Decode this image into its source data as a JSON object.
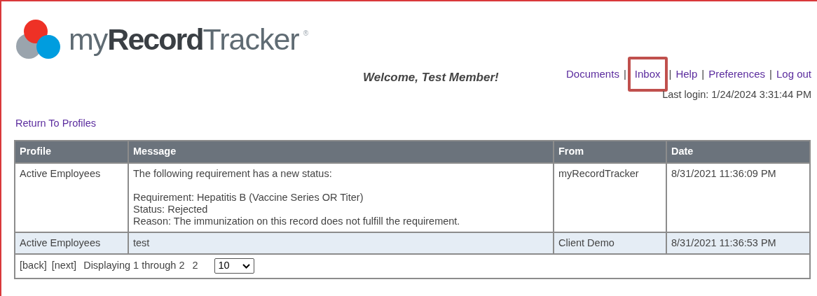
{
  "logo": {
    "text": "my**Record**Tracker",
    "mark": "®"
  },
  "welcome": "Welcome, Test Member!",
  "nav": [
    {
      "label": "Documents",
      "highlighted": false
    },
    {
      "label": "Inbox",
      "highlighted": true
    },
    {
      "label": "Help",
      "highlighted": false
    },
    {
      "label": "Preferences",
      "highlighted": false
    },
    {
      "label": "Log out",
      "highlighted": false
    }
  ],
  "nav_separator": "|",
  "last_login": "Last login: 1/24/2024 3:31:44 PM",
  "return_link": "Return To Profiles",
  "table": {
    "columns": [
      "Profile",
      "Message",
      "From",
      "Date"
    ],
    "rows": [
      {
        "profile": "Active Employees",
        "message": [
          [
            "The following requirement has a new status:"
          ],
          [
            "Requirement: Hepatitis B (Vaccine Series OR Titer)",
            "Status: Rejected",
            "Reason: The immunization on this record does not fulfill the requirement."
          ]
        ],
        "from": "myRecordTracker",
        "date": "8/31/2021 11:36:09 PM"
      },
      {
        "profile": "Active Employees",
        "message": [
          [
            "test"
          ]
        ],
        "from": "Client Demo",
        "date": "8/31/2021 11:36:53 PM"
      }
    ]
  },
  "pager": {
    "back": "[back]",
    "next": "[next]",
    "display": "Displaying 1 through 2",
    "count": "2",
    "page_size": "10"
  }
}
